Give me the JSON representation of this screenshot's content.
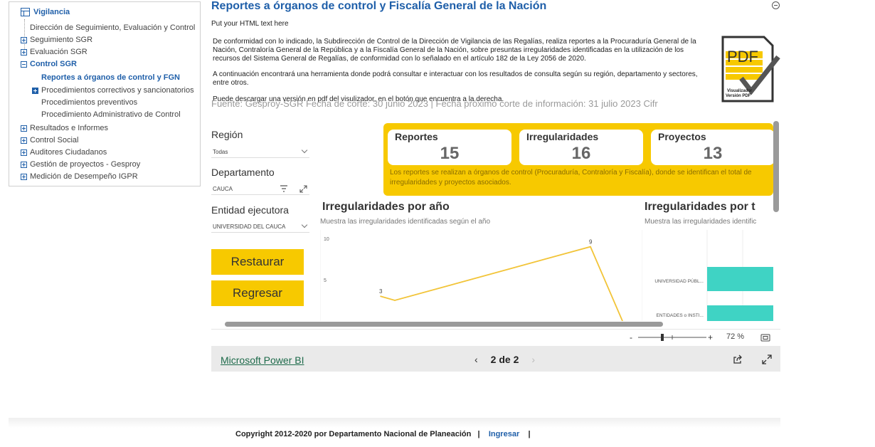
{
  "sidebar": {
    "header": "Vigilancia",
    "items": [
      {
        "label": "Dirección de Seguimiento, Evaluación y Control"
      },
      {
        "label": "Seguimiento SGR"
      },
      {
        "label": "Evaluación SGR"
      },
      {
        "label": "Control SGR"
      },
      {
        "label": "Reportes a órganos de control y FGN"
      },
      {
        "label": "Procedimientos correctivos y sancionatorios"
      },
      {
        "label": "Procedimientos preventivos"
      },
      {
        "label": "Procedimiento Administrativo de Control"
      },
      {
        "label": "Resultados e Informes"
      },
      {
        "label": "Control Social"
      },
      {
        "label": "Auditores Ciudadanos"
      },
      {
        "label": "Gestión de proyectos - Gesproy"
      },
      {
        "label": "Medición de Desempeño IGPR"
      }
    ]
  },
  "main": {
    "title": "Reportes a órganos de control y Fiscalía General de la Nación",
    "intro": "Put your HTML text here",
    "paragraphs": [
      "De conformidad con lo indicado, la Subdirección de Control de la Dirección de Vigilancia de las Regalías, realiza reportes a la Procuraduría General de la Nación, Contraloría General de la República y a la Fiscalía General de la Nación, sobre presuntas irregularidades identificadas en la utilización de los recursos del Sistema General de Regalías, de conformidad con lo señalado en el artículo 182 de la Ley 2056 de 2020.",
      "A continuación encontrará una herramienta donde podrá consultar e interactuar con los resultados de consulta según su región, departamento y sectores, entre otros.",
      "Puede descargar una versión en pdf del visulizador, en el botón que encuentra a la derecha."
    ],
    "pdf_icon": {
      "text": "PDF",
      "caption_1": "Visualizador",
      "caption_2": "Versión PDF"
    }
  },
  "report": {
    "ghost_text": "Fuente: Gesproy-SGR     Fecha de corte: 30 junio 2023 | Fecha próximo corte de información: 31 julio 2023     Cifr",
    "filters": {
      "region_label": "Región",
      "region_value": "Todas",
      "departamento_label": "Departamento",
      "departamento_value": "CAUCA",
      "entidad_label": "Entidad ejecutora",
      "entidad_value": "UNIVERSIDAD DEL CAUCA"
    },
    "buttons": {
      "restaurar": "Restaurar",
      "regresar": "Regresar"
    },
    "kpis": [
      {
        "label": "Reportes",
        "value": "15"
      },
      {
        "label": "Irregularidades",
        "value": "16"
      },
      {
        "label": "Proyectos",
        "value": "13"
      }
    ],
    "kpi_note": "Los reportes se realizan a órganos de control (Procuraduría, Contraloría y Fiscalía), donde se identifican el total de irregularidades y proyectos asociados.",
    "chart1": {
      "title": "Irregularidades por año",
      "subtitle": "Muestra las irregularidades identificadas según el año"
    },
    "chart2": {
      "title": "Irregularidades por t",
      "subtitle": "Muestra las irregularidades identific"
    },
    "zoom": "72 %",
    "powerbi_link": "Microsoft Power BI",
    "page_indicator": "2 de 2"
  },
  "chart_data": [
    {
      "type": "line",
      "title": "Irregularidades por año",
      "y_ticks": [
        "10",
        "5"
      ],
      "ylim": [
        0,
        10
      ],
      "series": [
        {
          "values": [
            3,
            2.5,
            9,
            0
          ]
        }
      ],
      "data_labels": [
        "3",
        "9"
      ],
      "color": "#f2c438"
    },
    {
      "type": "bar",
      "title": "Irregularidades por t",
      "categories": [
        "UNIVERSIDAD PÚBL...",
        "ENTIDADES o INSTI..."
      ],
      "color": "#3fd3c4"
    }
  ],
  "footer": {
    "copyright": "Copyright 2012-2020 por Departamento Nacional de Planeación",
    "sep": "|",
    "login": "Ingresar"
  }
}
